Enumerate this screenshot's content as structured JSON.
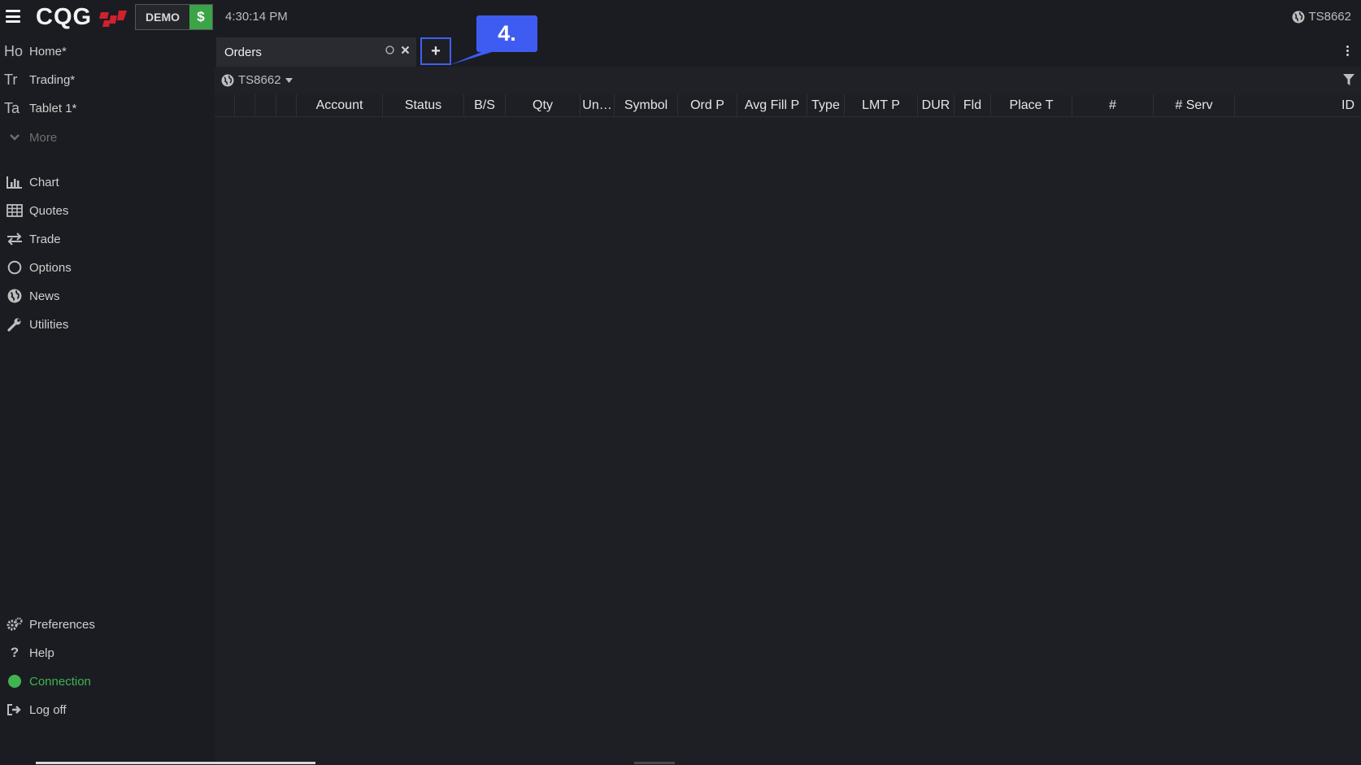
{
  "topbar": {
    "logo_text": "CQG",
    "mode": "DEMO",
    "currency_symbol": "$",
    "time": "4:30:14 PM",
    "account": "TS8662"
  },
  "sidebar": {
    "workspaces": [
      {
        "abbr": "Ho",
        "label": "Home*"
      },
      {
        "abbr": "Tr",
        "label": "Trading*"
      },
      {
        "abbr": "Ta",
        "label": "Tablet 1*"
      }
    ],
    "more_label": "More",
    "widgets": [
      {
        "icon": "bar-chart-icon",
        "label": "Chart"
      },
      {
        "icon": "table-grid-icon",
        "label": "Quotes"
      },
      {
        "icon": "swap-arrows-icon",
        "label": "Trade"
      },
      {
        "icon": "circle-icon",
        "label": "Options"
      },
      {
        "icon": "globe-icon",
        "label": "News"
      },
      {
        "icon": "wrench-icon",
        "label": "Utilities"
      }
    ],
    "bottom": [
      {
        "icon": "gears-icon",
        "label": "Preferences"
      },
      {
        "icon": "question-icon",
        "label": "Help"
      },
      {
        "icon": "status-dot-icon",
        "label": "Connection"
      },
      {
        "icon": "logoff-icon",
        "label": "Log off"
      }
    ],
    "connection_color": "#3fb451"
  },
  "main": {
    "tab_label": "Orders",
    "add_tab_symbol": "+",
    "callout_label": "4.",
    "account_filter": "TS8662",
    "columns": [
      "Account",
      "Status",
      "B/S",
      "Qty",
      "Un…",
      "Symbol",
      "Ord P",
      "Avg Fill P",
      "Type",
      "LMT P",
      "DUR",
      "Fld",
      "Place T",
      "#",
      "# Serv",
      "ID"
    ]
  },
  "colors": {
    "accent_blue": "#3e5cf2",
    "demo_green": "#3ba447",
    "logo_red": "#d0212e"
  }
}
